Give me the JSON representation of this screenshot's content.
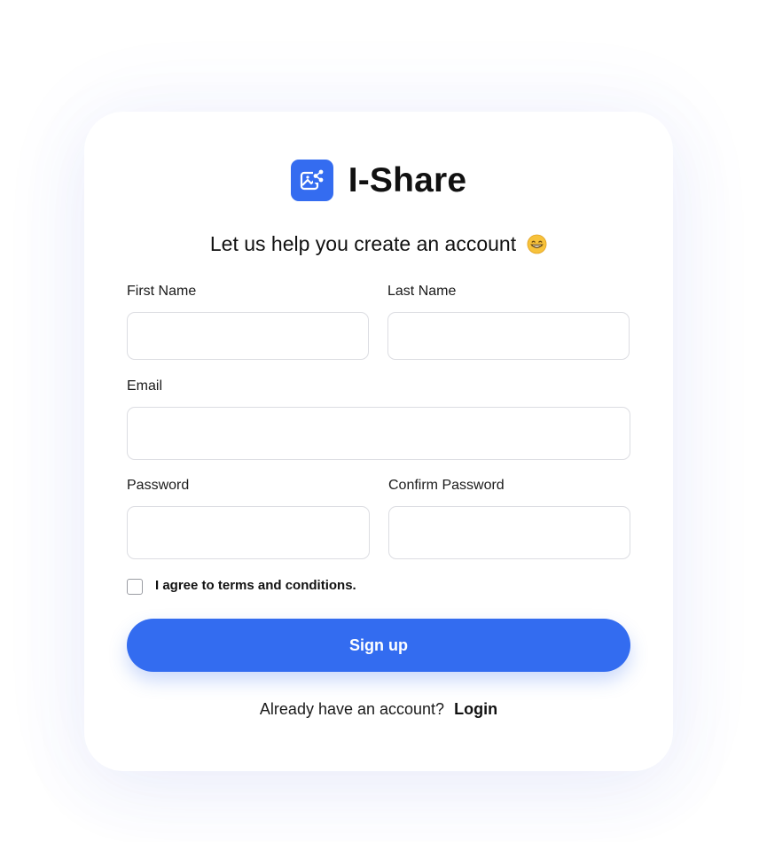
{
  "brand": {
    "name": "I-Share",
    "logo_icon": "image-share-icon",
    "accent_color": "#336cf0"
  },
  "subtitle": {
    "text": "Let us help you create an account",
    "emoji_icon": "grinning-face-emoji-icon"
  },
  "form": {
    "first_name": {
      "label": "First Name",
      "value": "",
      "placeholder": ""
    },
    "last_name": {
      "label": "Last Name",
      "value": "",
      "placeholder": ""
    },
    "email": {
      "label": "Email",
      "value": "",
      "placeholder": ""
    },
    "password": {
      "label": "Password",
      "value": "",
      "placeholder": ""
    },
    "confirm_password": {
      "label": "Confirm Password",
      "value": "",
      "placeholder": ""
    },
    "terms": {
      "label": "I agree to terms and conditions.",
      "checked": false
    },
    "submit_label": "Sign up"
  },
  "footer": {
    "prompt": "Already have an account?",
    "login_label": "Login"
  }
}
